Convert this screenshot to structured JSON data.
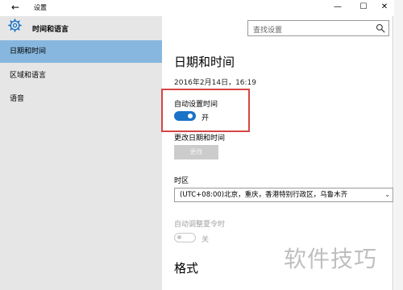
{
  "titlebar": {
    "back_glyph": "←",
    "title": "设置",
    "minimize_glyph": "—",
    "maximize_glyph": "☐",
    "close_glyph": "✕"
  },
  "header": {
    "icon": "gear-icon",
    "title": "时间和语言"
  },
  "search": {
    "placeholder": "查找设置",
    "icon": "search-icon"
  },
  "sidebar": {
    "items": [
      {
        "label": "日期和时间",
        "active": true
      },
      {
        "label": "区域和语言",
        "active": false
      },
      {
        "label": "语音",
        "active": false
      }
    ]
  },
  "main": {
    "title": "日期和时间",
    "current_datetime": "2016年2月14日，16:19",
    "auto_time": {
      "label": "自动设置时间",
      "state_label": "开",
      "on": true
    },
    "change_datetime": {
      "label": "更改日期和时间",
      "button_label": "更改",
      "enabled": false
    },
    "timezone": {
      "label": "时区",
      "value": "(UTC+08:00)北京，重庆，香港特别行政区，乌鲁木齐"
    },
    "dst": {
      "label": "自动调整夏令时",
      "state_label": "关",
      "on": false,
      "enabled": false
    },
    "format_title": "格式"
  },
  "colors": {
    "accent": "#1a73c6",
    "sidebar_bg": "#e6e6e6",
    "sidebar_active": "#87b7df",
    "highlight_box": "#d64545"
  },
  "watermark": "软件技巧"
}
